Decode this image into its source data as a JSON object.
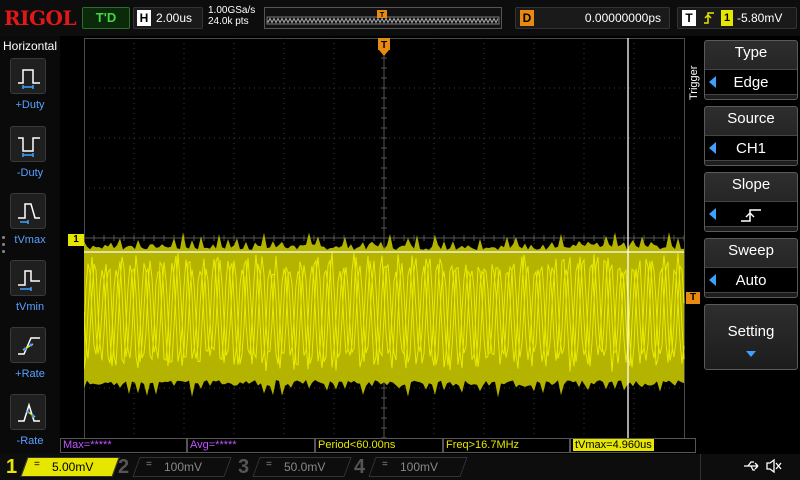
{
  "brand": "RIGOL",
  "topbar": {
    "status": "T'D",
    "horizontal": {
      "key": "H",
      "value": "2.00us"
    },
    "sample_rate": "1.00GSa/s",
    "memory_depth": "24.0k pts",
    "trigger_marker": "T",
    "delay": {
      "key": "D",
      "value": "0.00000000ps"
    },
    "trigger": {
      "key": "T",
      "source": "1",
      "level": "-5.80mV"
    }
  },
  "left_panel": {
    "title": "Horizontal",
    "items": [
      {
        "label": "+Duty",
        "icon": "positive-duty-icon"
      },
      {
        "label": "-Duty",
        "icon": "negative-duty-icon"
      },
      {
        "label": "tVmax",
        "icon": "tvmax-icon"
      },
      {
        "label": "tVmin",
        "icon": "tvmin-icon"
      },
      {
        "label": "+Rate",
        "icon": "positive-rate-icon"
      },
      {
        "label": "-Rate",
        "icon": "negative-rate-icon"
      }
    ]
  },
  "right_menu": {
    "title": "Trigger",
    "items": [
      {
        "title": "Type",
        "value": "Edge"
      },
      {
        "title": "Source",
        "value": "CH1"
      },
      {
        "title": "Slope",
        "value": "rising-edge-icon"
      },
      {
        "title": "Sweep",
        "value": "Auto"
      },
      {
        "title": "Setting"
      }
    ]
  },
  "markers": {
    "ch1": "1",
    "trigger_level": "T"
  },
  "measurements": {
    "max": "Max=*****",
    "avg": "Avg=*****",
    "period": "Period<60.00ns",
    "freq": "Freq>16.7MHz",
    "tvmax": "tVmax=4.960us"
  },
  "channels": [
    {
      "num": "1",
      "symbol": "=",
      "scale": "5.00mV"
    },
    {
      "num": "2",
      "symbol": "=",
      "scale": "100mV"
    },
    {
      "num": "3",
      "symbol": "=",
      "scale": "50.0mV"
    },
    {
      "num": "4",
      "symbol": "=",
      "scale": "100mV"
    }
  ],
  "colors": {
    "ch1": "#e6e600",
    "grid": "#3a3a3a",
    "trigger": "#e88a10",
    "menu_accent": "#3fa0ff",
    "brand": "#e01818"
  }
}
